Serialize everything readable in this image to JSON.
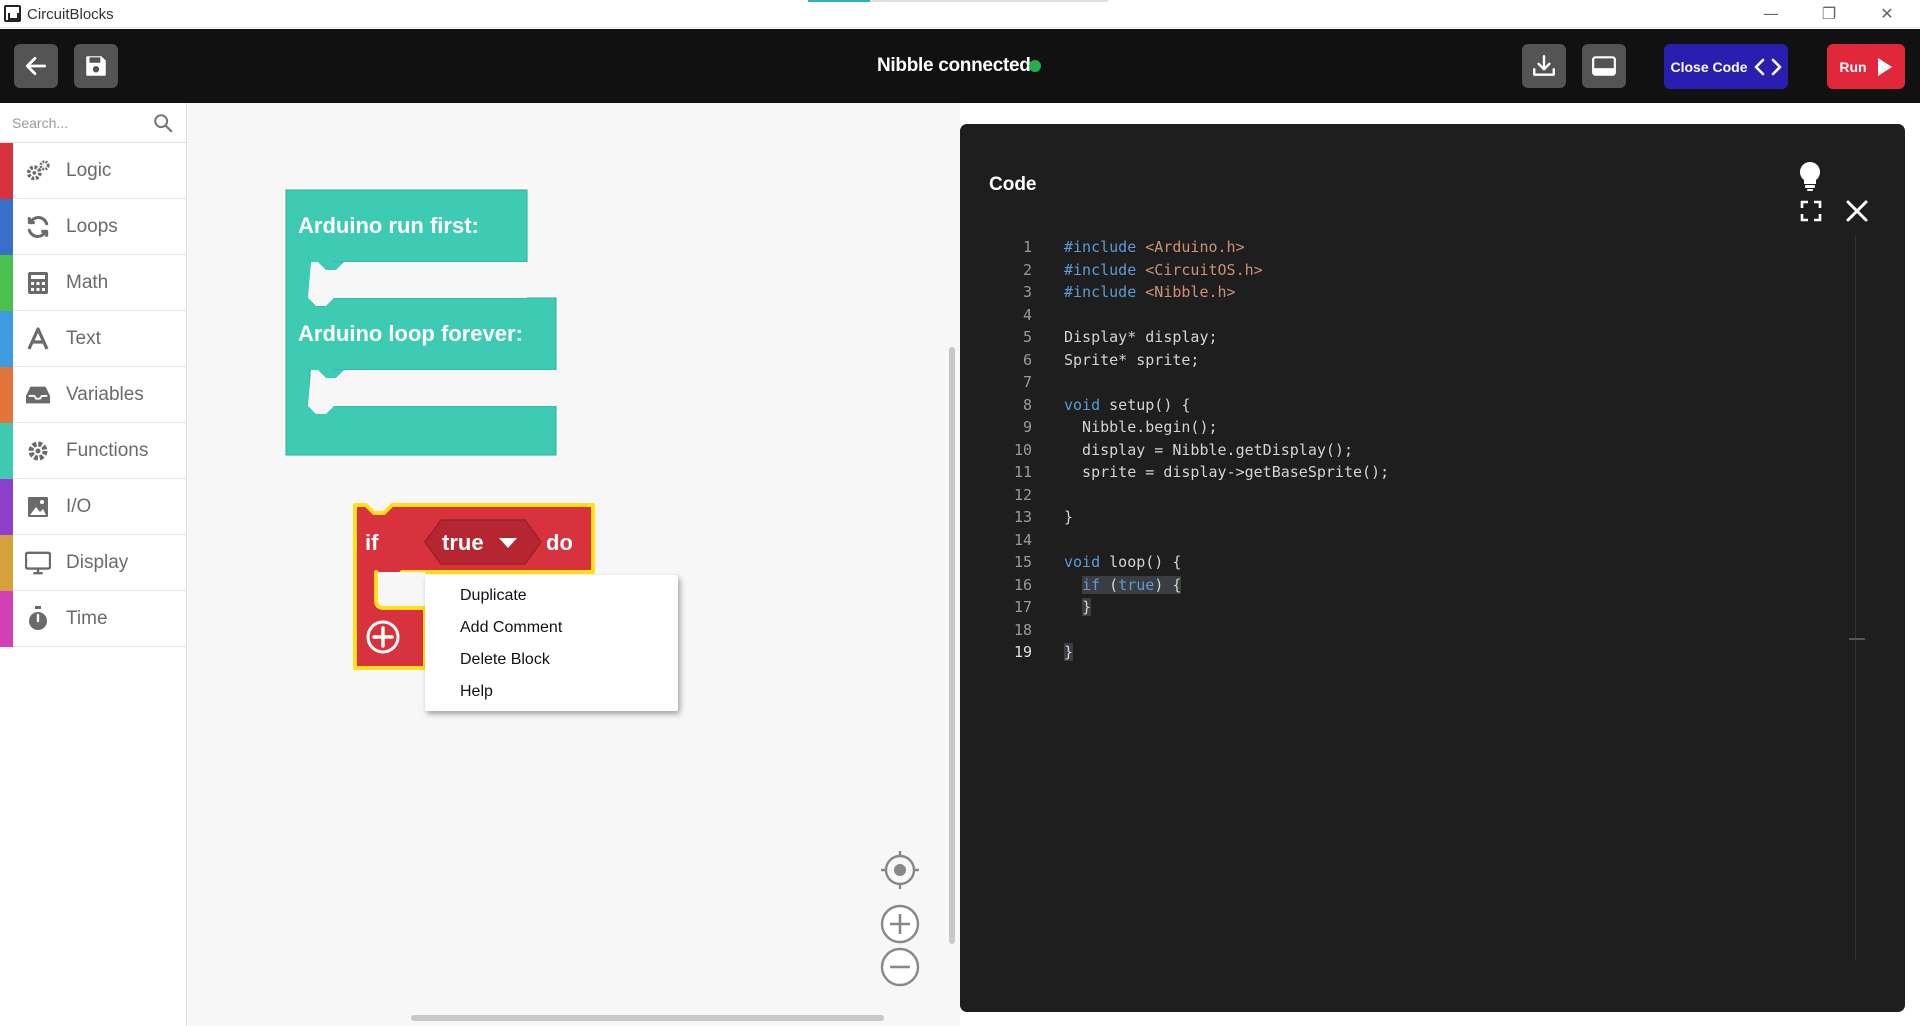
{
  "window": {
    "title": "CircuitBlocks",
    "controls": {
      "minimize": "—",
      "restore": "❐",
      "close": "✕"
    }
  },
  "toolbar": {
    "status_text": "Nibble connected",
    "status_color": "#21b04b",
    "close_code_label": "Close Code",
    "run_label": "Run",
    "accent_blue": "#2a1eb0",
    "accent_red": "#e0283a"
  },
  "sidebar": {
    "search_placeholder": "Search...",
    "categories": [
      {
        "label": "Logic",
        "color": "#d7323d",
        "icon": "gears-icon"
      },
      {
        "label": "Loops",
        "color": "#3a6fc9",
        "icon": "refresh-icon"
      },
      {
        "label": "Math",
        "color": "#4cc04c",
        "icon": "calculator-icon"
      },
      {
        "label": "Text",
        "color": "#3f9be0",
        "icon": "letter-a-icon"
      },
      {
        "label": "Variables",
        "color": "#e2733b",
        "icon": "inbox-icon"
      },
      {
        "label": "Functions",
        "color": "#3ec9b0",
        "icon": "gear-icon"
      },
      {
        "label": "I/O",
        "color": "#8e3fcc",
        "icon": "image-icon"
      },
      {
        "label": "Display",
        "color": "#d6a13a",
        "icon": "monitor-icon"
      },
      {
        "label": "Time",
        "color": "#d23fb7",
        "icon": "stopwatch-icon"
      }
    ]
  },
  "workspace": {
    "setup_block_label": "Arduino run first:",
    "loop_block_label": "Arduino loop forever:",
    "if_label": "if",
    "condition_value": "true",
    "do_label": "do",
    "block_teal": "#3ecbb4",
    "block_red": "#d7323d",
    "selection_yellow": "#ffe01a",
    "context_menu": [
      "Duplicate",
      "Add Comment",
      "Delete Block",
      "Help"
    ]
  },
  "code_panel": {
    "title": "Code",
    "lines": [
      {
        "n": "1",
        "text": "#include <Arduino.h>"
      },
      {
        "n": "2",
        "text": "#include <CircuitOS.h>"
      },
      {
        "n": "3",
        "text": "#include <Nibble.h>"
      },
      {
        "n": "4",
        "text": ""
      },
      {
        "n": "5",
        "text": "Display* display;"
      },
      {
        "n": "6",
        "text": "Sprite* sprite;"
      },
      {
        "n": "7",
        "text": ""
      },
      {
        "n": "8",
        "text": "void setup() {"
      },
      {
        "n": "9",
        "text": "  Nibble.begin();"
      },
      {
        "n": "10",
        "text": "  display = Nibble.getDisplay();"
      },
      {
        "n": "11",
        "text": "  sprite = display->getBaseSprite();"
      },
      {
        "n": "12",
        "text": ""
      },
      {
        "n": "13",
        "text": "}"
      },
      {
        "n": "14",
        "text": ""
      },
      {
        "n": "15",
        "text": "void loop() {"
      },
      {
        "n": "16",
        "text": "  if (true) {"
      },
      {
        "n": "17",
        "text": "  }"
      },
      {
        "n": "18",
        "text": ""
      },
      {
        "n": "19",
        "text": "}"
      }
    ]
  }
}
